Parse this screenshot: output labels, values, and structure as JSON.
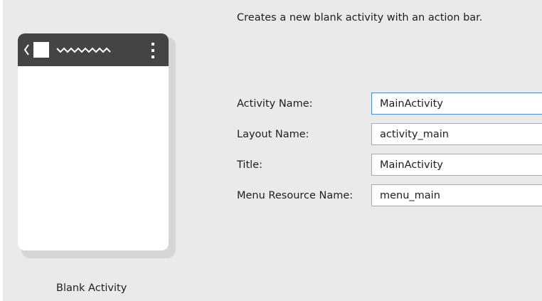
{
  "header": {
    "description": "Creates a new blank activity with an action bar."
  },
  "preview": {
    "template_name": "Blank Activity",
    "actionbar_color": "#444444",
    "back_icon": "chevron-left-icon",
    "app_icon": "app-icon",
    "title_placeholder": "squiggle-title-icon",
    "overflow_icon": "overflow-menu-icon"
  },
  "form": {
    "activity_name": {
      "label": "Activity Name:",
      "value": "MainActivity",
      "focused": true
    },
    "layout_name": {
      "label": "Layout Name:",
      "value": "activity_main"
    },
    "title": {
      "label": "Title:",
      "value": "MainActivity"
    },
    "menu_resource_name": {
      "label": "Menu Resource Name:",
      "value": "menu_main"
    }
  }
}
